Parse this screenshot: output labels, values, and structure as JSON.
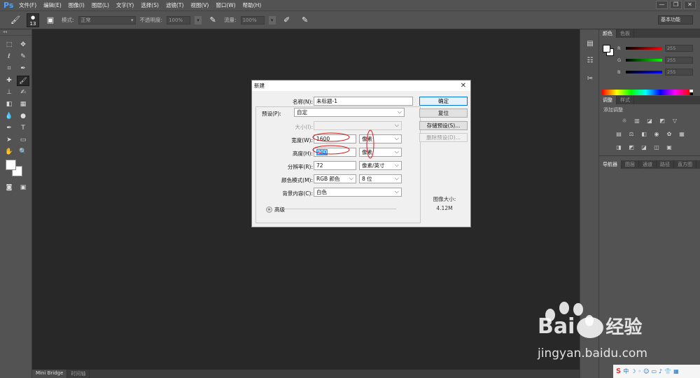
{
  "app": {
    "logo": "Ps"
  },
  "menu": [
    "文件(F)",
    "编辑(E)",
    "图像(I)",
    "图层(L)",
    "文字(Y)",
    "选择(S)",
    "滤镜(T)",
    "视图(V)",
    "窗口(W)",
    "帮助(H)"
  ],
  "window_controls": [
    "—",
    "❐",
    "✕"
  ],
  "options_bar": {
    "brush_size": "13",
    "mode_label": "模式:",
    "mode_value": "正常",
    "opacity_label": "不透明度:",
    "opacity_value": "100%",
    "flow_label": "流量:",
    "flow_value": "100%",
    "workspace": "基本功能"
  },
  "bottom_tabs": [
    "Mini Bridge",
    "时间轴"
  ],
  "panels": {
    "color_tabs": [
      "颜色",
      "色板"
    ],
    "sliders": [
      {
        "label": "R",
        "value": "255",
        "gradient": "linear-gradient(to right,#000,#f00)"
      },
      {
        "label": "G",
        "value": "255",
        "gradient": "linear-gradient(to right,#000,#0f0)"
      },
      {
        "label": "B",
        "value": "255",
        "gradient": "linear-gradient(to right,#000,#00f)"
      }
    ],
    "adjust_tabs": [
      "调整",
      "样式"
    ],
    "adjust_title": "添加调整",
    "nav_tabs": [
      "导航器",
      "图层",
      "通道",
      "路径",
      "直方图"
    ]
  },
  "dialog": {
    "title": "新建",
    "name_label": "名称(N):",
    "name_value": "未标题-1",
    "preset_label": "预设(P):",
    "preset_value": "自定",
    "size_label": "大小(I):",
    "width_label": "宽度(W):",
    "width_value": "1600",
    "width_unit": "像素",
    "height_label": "高度(H):",
    "height_value": "900",
    "height_unit": "像素",
    "resolution_label": "分辨率(R):",
    "resolution_value": "72",
    "resolution_unit": "像素/英寸",
    "color_mode_label": "颜色模式(M):",
    "color_mode_value": "RGB 颜色",
    "bit_depth": "8 位",
    "background_label": "背景内容(C):",
    "background_value": "白色",
    "advanced_label": "高级",
    "ok_button": "确定",
    "reset_button": "复位",
    "save_preset_button": "存储预设(S)...",
    "delete_preset_button": "删除预设(D)...",
    "image_size_label": "图像大小:",
    "image_size_value": "4.12M"
  },
  "watermark": {
    "brand": "Bai",
    "brand_cn": "经验",
    "url": "jingyan.baidu.com"
  },
  "colors": {
    "annotation": "#e01818",
    "accent": "#4ba3ff"
  }
}
